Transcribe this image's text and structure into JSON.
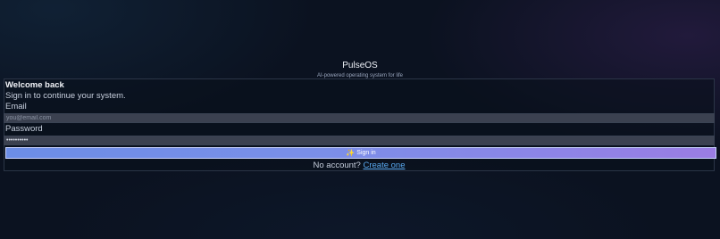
{
  "brand": {
    "name": "PulseOS",
    "tagline": "AI-powered operating system for life"
  },
  "login": {
    "title": "Welcome back",
    "subtitle": "Sign in to continue your system.",
    "email": {
      "label": "Email",
      "placeholder": "you@email.com",
      "value": ""
    },
    "password": {
      "label": "Password",
      "value": "••••••••••"
    },
    "submit": {
      "icon": "sparkle-icon",
      "label": "Sign in"
    },
    "footer": {
      "prompt": "No account?",
      "link_label": "Create one"
    }
  },
  "colors": {
    "background": "#0b1220",
    "button_gradient_start": "#6c8ee6",
    "button_gradient_end": "#9a7de4",
    "link": "#5aa9f0"
  }
}
